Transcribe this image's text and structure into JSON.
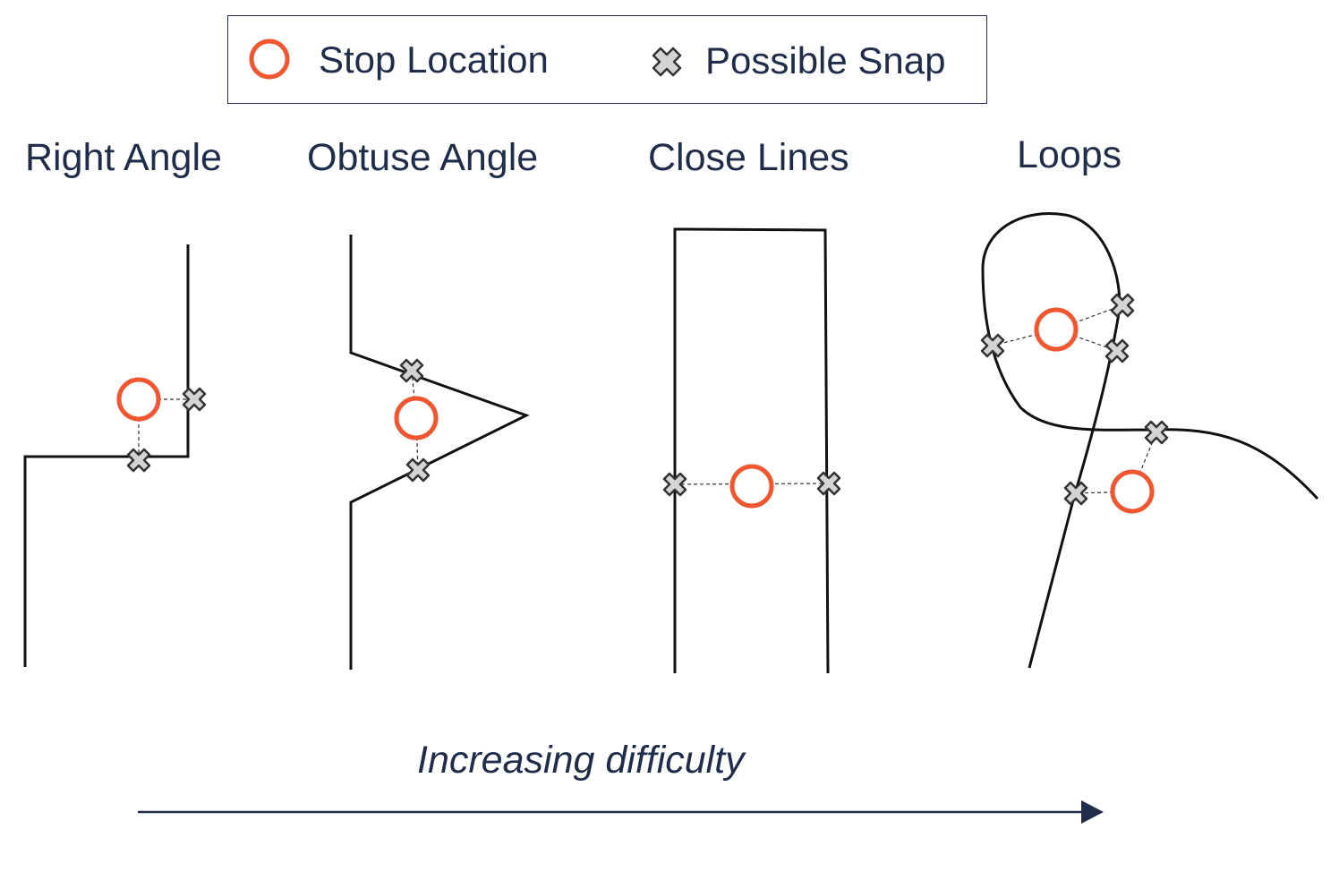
{
  "legend": {
    "stop_label": "Stop Location",
    "snap_label": "Possible Snap",
    "stop_icon": "orange-circle-icon",
    "snap_icon": "gray-cross-icon"
  },
  "panels": [
    {
      "title": "Right Angle"
    },
    {
      "title": "Obtuse Angle"
    },
    {
      "title": "Close Lines"
    },
    {
      "title": "Loops"
    }
  ],
  "footer": {
    "difficulty_label": "Increasing difficulty",
    "arrow_icon": "right-arrow-icon"
  },
  "colors": {
    "stop": "#f0562f",
    "snap_fill": "#d4d4d4",
    "snap_stroke": "#333333",
    "line": "#111111",
    "text": "#1f2d4a"
  }
}
